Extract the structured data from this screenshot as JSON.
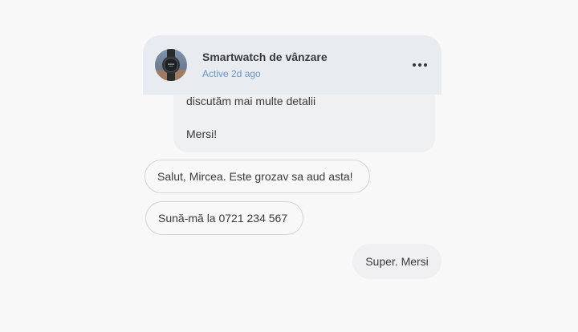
{
  "header": {
    "title": "Smartwatch de vânzare",
    "status": "Active 2d ago",
    "avatar_icon": "smartwatch-photo",
    "menu_icon": "more-horizontal-icon"
  },
  "messages": [
    {
      "direction": "received",
      "lines": [
        "discutăm mai multe detalii",
        "Mersi!"
      ]
    },
    {
      "direction": "received",
      "text": "Salut, Mircea. Este grozav sa aud asta!"
    },
    {
      "direction": "received",
      "text": "Sună-mă la 0721 234 567"
    },
    {
      "direction": "sent",
      "text": "Super. Mersi"
    }
  ],
  "colors": {
    "header_bg": "#e8ebf0",
    "status_text": "#6a95c4",
    "received_bubble_bg": "#eef0f2",
    "sent_bubble_bg": "#f0f0f2",
    "outlined_border": "#d4d4d4",
    "page_bg": "#f8f8f8"
  }
}
